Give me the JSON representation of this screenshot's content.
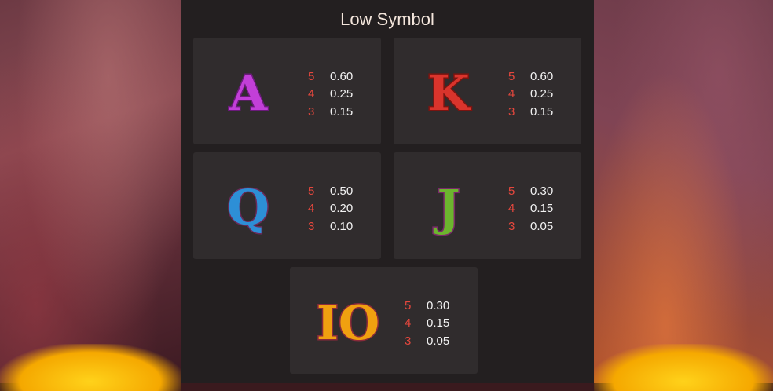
{
  "header": {
    "title": "Low Symbol"
  },
  "symbols": [
    {
      "name": "A",
      "color": "#c23fd8",
      "pays": [
        {
          "count": "5",
          "value": "0.60"
        },
        {
          "count": "4",
          "value": "0.25"
        },
        {
          "count": "3",
          "value": "0.15"
        }
      ]
    },
    {
      "name": "K",
      "color": "#d9342c",
      "pays": [
        {
          "count": "5",
          "value": "0.60"
        },
        {
          "count": "4",
          "value": "0.25"
        },
        {
          "count": "3",
          "value": "0.15"
        }
      ]
    },
    {
      "name": "Q",
      "color": "#2d8fd6",
      "pays": [
        {
          "count": "5",
          "value": "0.50"
        },
        {
          "count": "4",
          "value": "0.20"
        },
        {
          "count": "3",
          "value": "0.10"
        }
      ]
    },
    {
      "name": "J",
      "color": "#6cb52e",
      "pays": [
        {
          "count": "5",
          "value": "0.30"
        },
        {
          "count": "4",
          "value": "0.15"
        },
        {
          "count": "3",
          "value": "0.05"
        }
      ]
    },
    {
      "name": "10",
      "display": "IO",
      "color": "#f0a010",
      "pays": [
        {
          "count": "5",
          "value": "0.30"
        },
        {
          "count": "4",
          "value": "0.15"
        },
        {
          "count": "3",
          "value": "0.05"
        }
      ]
    }
  ]
}
